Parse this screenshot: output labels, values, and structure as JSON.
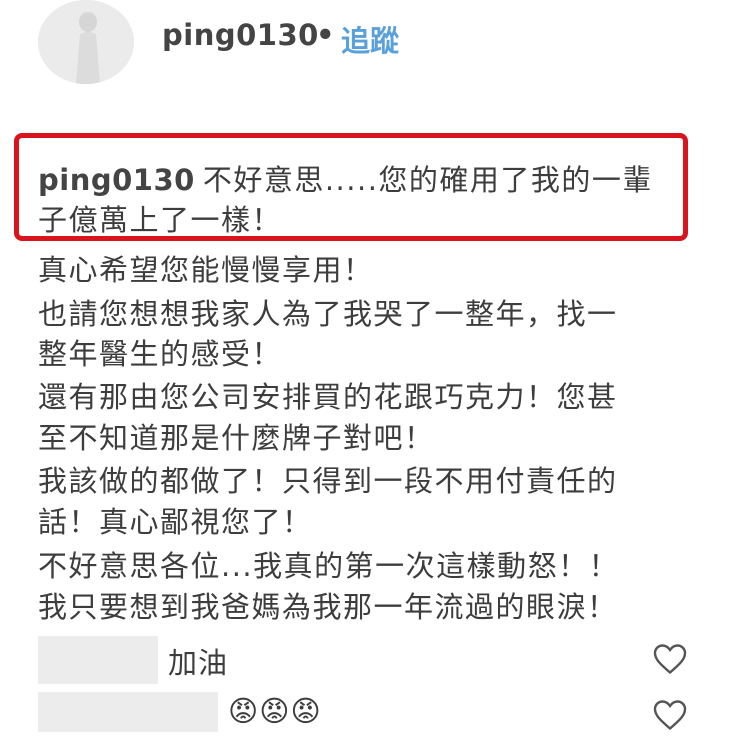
{
  "post": {
    "username": "ping0130",
    "separator": "•",
    "follow_label": "追蹤"
  },
  "comment": {
    "author": "ping0130",
    "lines": [
      "不好意思.....您的確用了我的一輩",
      "子億萬上了一樣！",
      "真心希望您能慢慢享用！",
      "也請您想想我家人為了我哭了一整年，找一",
      "整年醫生的感受！",
      "還有那由您公司安排買的花跟巧克力！您甚",
      "至不知道那是什麼牌子對吧！",
      "我該做的都做了！只得到一段不用付責任的",
      "話！真心鄙視您了！",
      "不好意思各位...我真的第一次這樣動怒！！",
      "我只要想到我爸媽為我那一年流過的眼淚！"
    ]
  },
  "replies": [
    {
      "text": "加油",
      "icon": "heart-icon"
    },
    {
      "text": "😡😡😡",
      "icon": "heart-icon"
    }
  ],
  "colors": {
    "highlight_border": "#d9141c",
    "follow_link": "#5aa0db"
  }
}
